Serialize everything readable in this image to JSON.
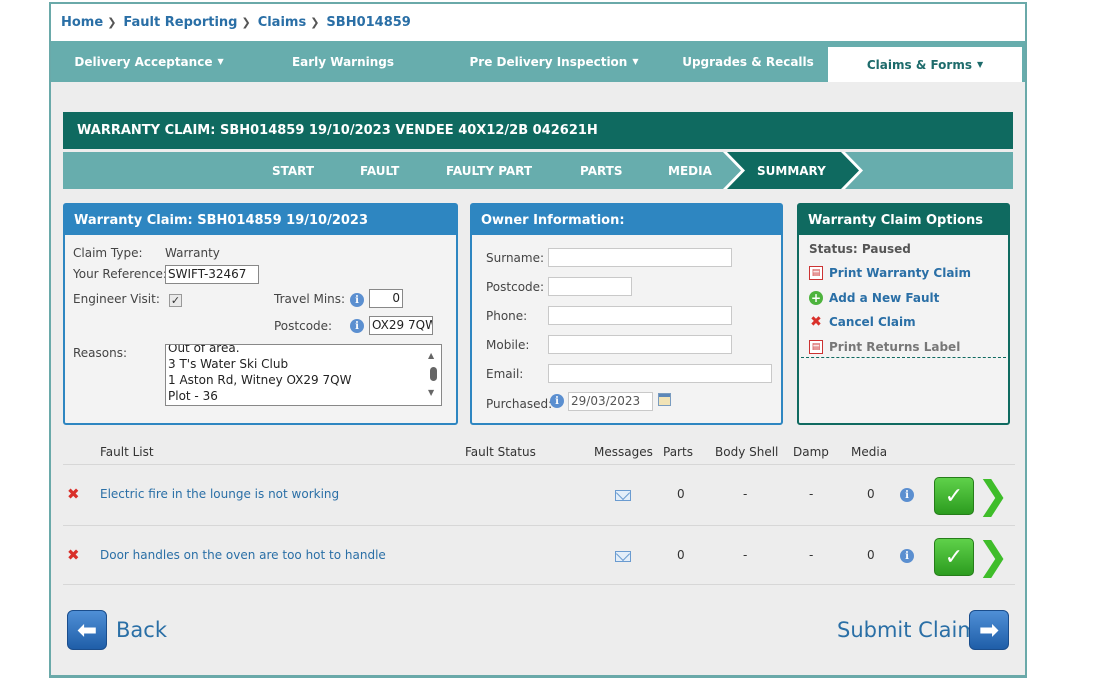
{
  "breadcrumb": [
    {
      "label": "Home"
    },
    {
      "label": "Fault Reporting"
    },
    {
      "label": "Claims"
    },
    {
      "label": "SBH014859"
    }
  ],
  "topnav": {
    "delivery": "Delivery Acceptance",
    "early": "Early Warnings",
    "pdi": "Pre Delivery Inspection",
    "upgrades": "Upgrades & Recalls",
    "claims": "Claims & Forms"
  },
  "claim_header": "WARRANTY CLAIM: SBH014859 19/10/2023 VENDEE 40X12/2B 042621H",
  "steps": {
    "start": "START",
    "fault": "FAULT",
    "faulty_part": "FAULTY PART",
    "parts": "PARTS",
    "media": "MEDIA",
    "summary": "SUMMARY"
  },
  "claim_panel": {
    "title": "Warranty Claim: SBH014859 19/10/2023",
    "claim_type_label": "Claim Type:",
    "claim_type": "Warranty",
    "your_ref_label": "Your Reference:",
    "your_ref": "SWIFT-32467",
    "engineer_label": "Engineer Visit:",
    "engineer_checked": "✓",
    "travel_label": "Travel Mins:",
    "travel_value": "0",
    "postcode_label": "Postcode:",
    "postcode_value": "OX29 7QW",
    "reasons_label": "Reasons:",
    "reasons_lines": [
      "Out of area.",
      "3 T's Water Ski Club",
      "1 Aston Rd, Witney OX29 7QW",
      "Plot - 36"
    ]
  },
  "owner_panel": {
    "title": "Owner Information:",
    "surname_label": "Surname:",
    "surname": "",
    "postcode_label": "Postcode:",
    "postcode": "",
    "phone_label": "Phone:",
    "phone": "",
    "mobile_label": "Mobile:",
    "mobile": "",
    "email_label": "Email:",
    "email": "",
    "purchased_label": "Purchased:",
    "purchased": "29/03/2023"
  },
  "options_panel": {
    "title": "Warranty Claim Options",
    "status": "Status: Paused",
    "print_claim": "Print Warranty Claim",
    "add_fault": "Add a New Fault",
    "cancel_claim": "Cancel Claim",
    "print_returns": "Print Returns Label"
  },
  "fault_table": {
    "headers": {
      "fault_list": "Fault List",
      "fault_status": "Fault Status",
      "messages": "Messages",
      "parts": "Parts",
      "body_shell": "Body Shell",
      "damp": "Damp",
      "media": "Media"
    },
    "rows": [
      {
        "description": "Electric fire in the lounge is not working",
        "status": "",
        "parts": "0",
        "body_shell": "-",
        "damp": "-",
        "media": "0"
      },
      {
        "description": "Door handles on the oven are too hot to handle",
        "status": "",
        "parts": "0",
        "body_shell": "-",
        "damp": "-",
        "media": "0"
      }
    ]
  },
  "footer": {
    "back": "Back",
    "submit": "Submit Claim"
  },
  "colors": {
    "teal": "#67adad",
    "dark_green": "#0f6a60",
    "blue": "#2e86c1",
    "link": "#2a6fa6"
  },
  "icons": [
    "chevron-right-icon",
    "caret-down-icon",
    "info-icon",
    "pdf-icon",
    "add-icon",
    "cancel-icon",
    "mail-icon",
    "tick-icon",
    "arrow-right-icon",
    "arrow-left-icon",
    "calendar-icon"
  ]
}
